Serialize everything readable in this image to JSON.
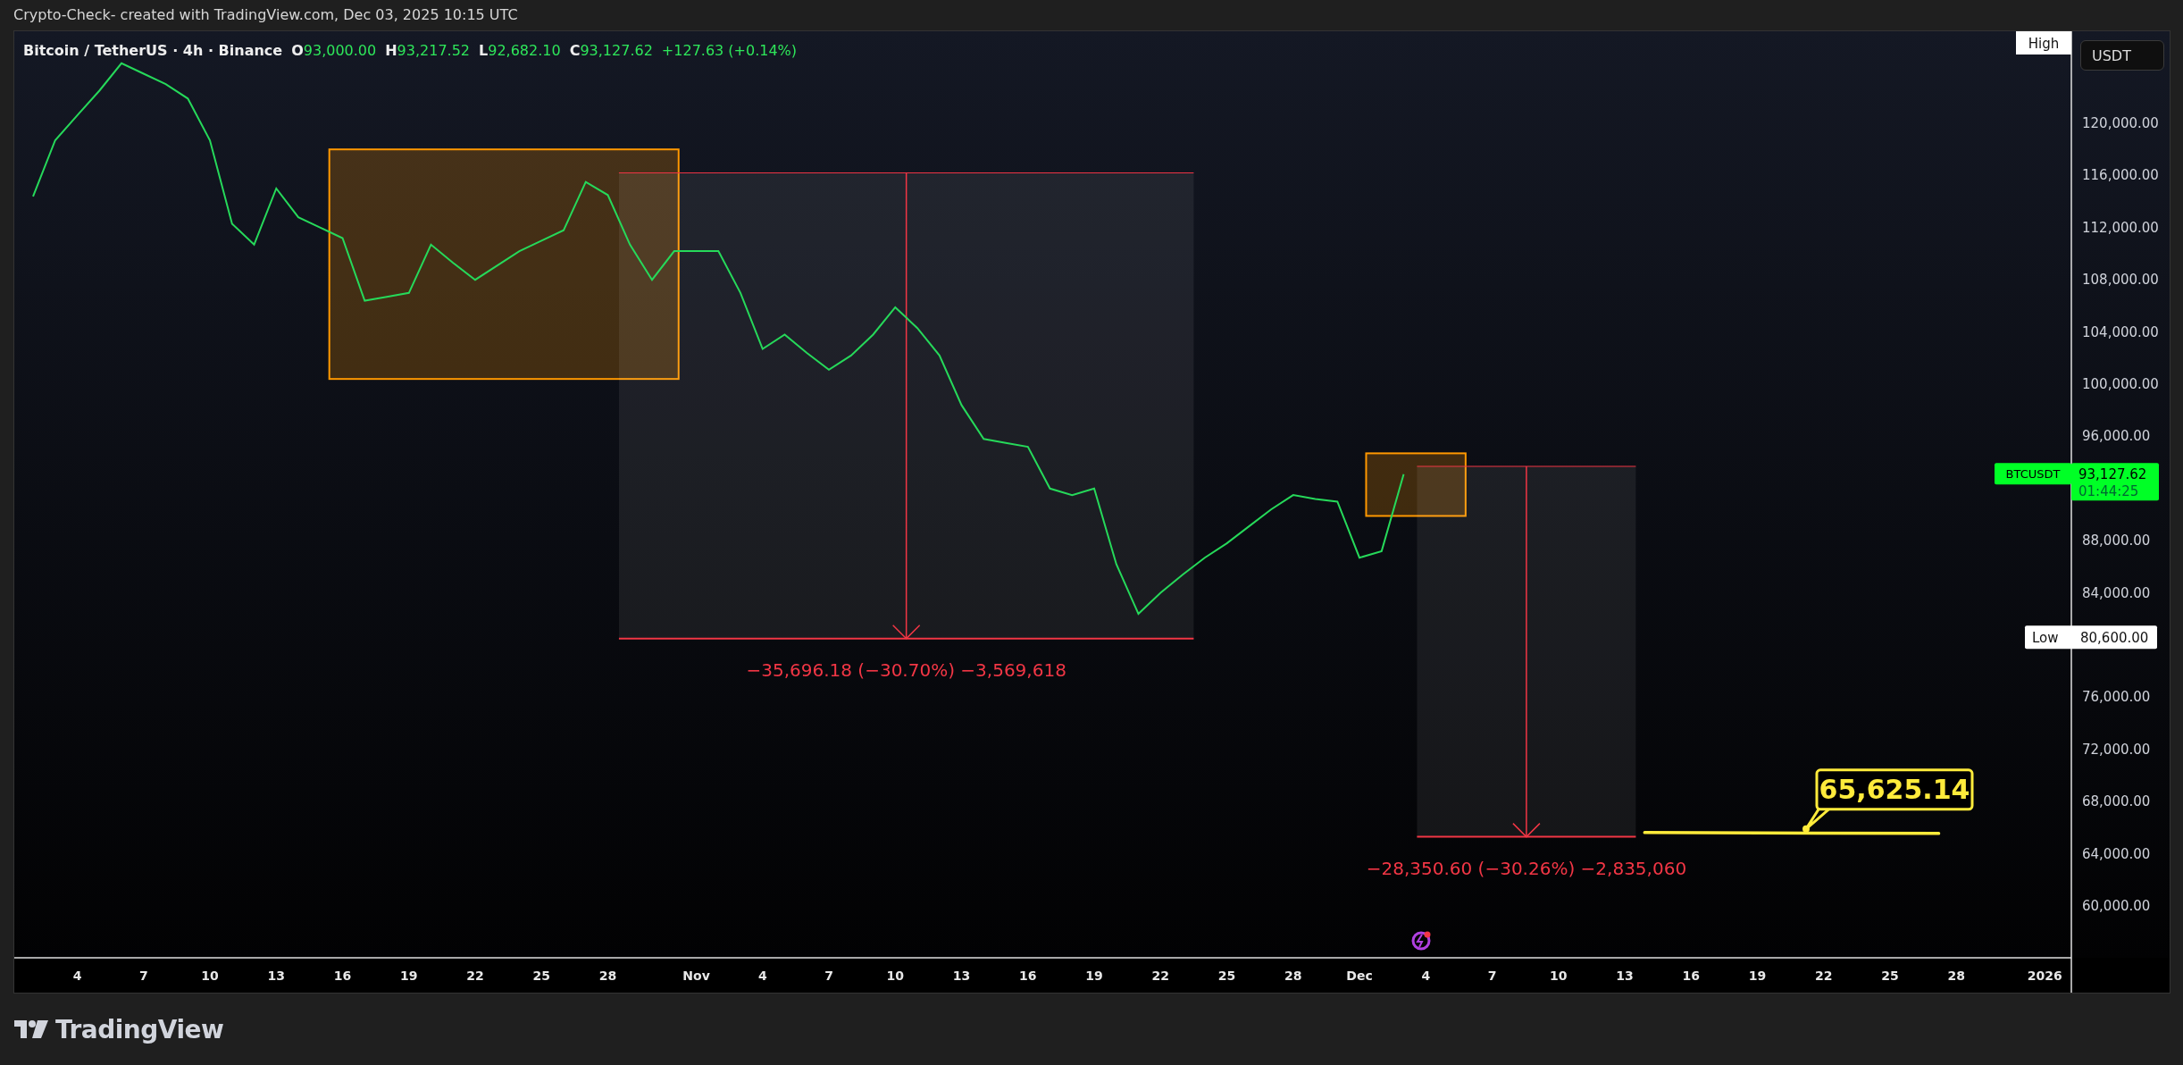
{
  "header": {
    "text": "Crypto-Check- created with TradingView.com, Dec 03, 2025 10:15 UTC"
  },
  "legend": {
    "symbol": "Bitcoin / TetherUS · 4h · Binance",
    "values": [
      {
        "label": "O",
        "value": "93,000.00"
      },
      {
        "label": "H",
        "value": "93,217.52"
      },
      {
        "label": "L",
        "value": "92,682.10"
      },
      {
        "label": "C",
        "value": "93,127.62"
      }
    ],
    "change": "+127.63 (+0.14%)"
  },
  "currency_button": "USDT",
  "chart": {
    "chart_data": {
      "type": "line",
      "ylim": [
        56027,
        127055
      ],
      "categories": [
        null,
        null,
        null,
        "4",
        null,
        null,
        "7",
        null,
        null,
        "10",
        null,
        null,
        "13",
        null,
        null,
        "16",
        null,
        null,
        "19",
        null,
        null,
        "22",
        null,
        null,
        "25",
        null,
        null,
        "28",
        null,
        null,
        null,
        "Nov",
        null,
        null,
        "4",
        null,
        null,
        "7",
        null,
        null,
        "10",
        null,
        null,
        "13",
        null,
        null,
        "16",
        null,
        null,
        "19",
        null,
        null,
        "22",
        null,
        null,
        "25",
        null,
        null,
        "28",
        null,
        null,
        "Dec",
        null,
        null,
        "4",
        null,
        null,
        "7",
        null,
        null,
        "10",
        null,
        null,
        "13",
        null,
        null,
        "16",
        null,
        null,
        "19",
        null,
        null,
        "22",
        null,
        null,
        "25",
        null,
        null,
        "28",
        null,
        null,
        null,
        "2026"
      ],
      "series": [
        {
          "name": "BTCUSDT",
          "color": "#26d95a",
          "values": [
            null,
            114400,
            118700,
            120600,
            122500,
            124600,
            123800,
            123000,
            121900,
            118700,
            112300,
            110700,
            115000,
            112800,
            112000,
            111200,
            106400,
            106700,
            107000,
            110700,
            109300,
            108000,
            109100,
            110200,
            111000,
            111800,
            115500,
            114500,
            110700,
            108000,
            110200,
            110200,
            110200,
            107000,
            102700,
            103800,
            102400,
            101100,
            102200,
            103800,
            105900,
            104300,
            102200,
            98400,
            95800,
            95500,
            95200,
            92000,
            91500,
            92000,
            86200,
            82400,
            84000,
            85400,
            86700,
            87800,
            89100,
            90400,
            91500,
            91200,
            91000,
            86700,
            87200,
            93100,
            null,
            null,
            null,
            null,
            null,
            null,
            null,
            null,
            null,
            null,
            null,
            null,
            null,
            null,
            null,
            null,
            null,
            null,
            null,
            null,
            null,
            null,
            null,
            null,
            null,
            null,
            null,
            null,
            null
          ]
        }
      ],
      "yticks": [
        {
          "value": 60000,
          "label": "60,000.00"
        },
        {
          "value": 64000,
          "label": "64,000.00"
        },
        {
          "value": 68000,
          "label": "68,000.00"
        },
        {
          "value": 72000,
          "label": "72,000.00"
        },
        {
          "value": 76000,
          "label": "76,000.00"
        },
        {
          "value": 84000,
          "label": "84,000.00"
        },
        {
          "value": 88000,
          "label": "88,000.00"
        },
        {
          "value": 96000,
          "label": "96,000.00"
        },
        {
          "value": 100000,
          "label": "100,000.00"
        },
        {
          "value": 104000,
          "label": "104,000.00"
        },
        {
          "value": 108000,
          "label": "108,000.00"
        },
        {
          "value": 112000,
          "label": "112,000.00"
        },
        {
          "value": 116000,
          "label": "116,000.00"
        },
        {
          "value": 120000,
          "label": "120,000.00"
        }
      ]
    },
    "drawings": [
      {
        "kind": "rectangle"
      },
      {
        "kind": "measure",
        "label": "−35,696.18 (−30.70%) −3,569,618"
      },
      {
        "kind": "rectangle"
      },
      {
        "kind": "measure",
        "label": "−28,350.60 (−30.26%) −2,835,060"
      },
      {
        "kind": "target",
        "label": "65,625.14"
      }
    ],
    "markers": [
      {
        "kind": "high",
        "label": "High"
      },
      {
        "kind": "last",
        "value": "93,127.62",
        "countdown": "01:44:25"
      },
      {
        "kind": "low",
        "label": "Low",
        "value": "80,600.00"
      }
    ]
  },
  "footer": {
    "logo": "TradingView"
  }
}
